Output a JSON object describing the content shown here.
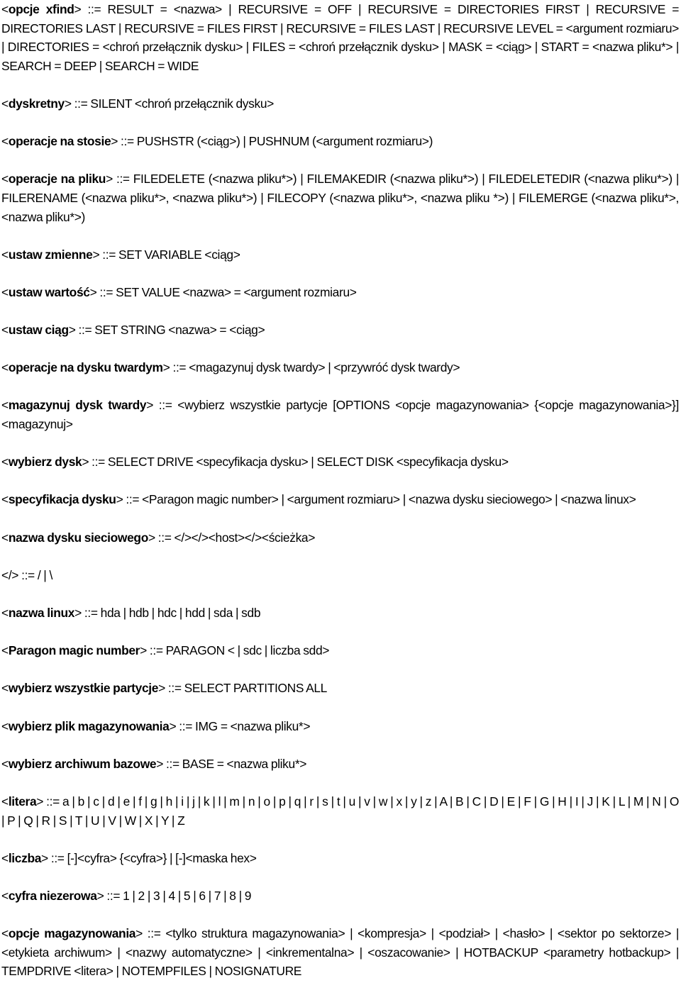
{
  "document": {
    "language": "pl",
    "rules": [
      {
        "term": "opcje xfind",
        "definition": " ::= RESULT = <nazwa> | RECURSIVE = OFF | RECURSIVE = DIRECTORIES FIRST | RECURSIVE = DIRECTORIES LAST | RECURSIVE = FILES FIRST | RECURSIVE = FILES LAST | RECURSIVE LEVEL = <argument rozmiaru> | DIRECTORIES = <chroń przełącznik dysku> | FILES = <chroń przełącznik dysku> | MASK = <ciąg> | START = <nazwa pliku*> | SEARCH = DEEP | SEARCH = WIDE"
      },
      {
        "term": "dyskretny",
        "definition": " ::= SILENT <chroń przełącznik dysku>"
      },
      {
        "term": "operacje na stosie",
        "definition": " ::= PUSHSTR (<ciąg>) | PUSHNUM (<argument rozmiaru>)"
      },
      {
        "term": "operacje na pliku",
        "definition": " ::= FILEDELETE (<nazwa pliku*>) | FILEMAKEDIR (<nazwa pliku*>) | FILEDELETEDIR (<nazwa pliku*>) | FILERENAME (<nazwa pliku*>, <nazwa pliku*>) | FILECOPY (<nazwa pliku*>, <nazwa pliku *>) | FILEMERGE (<nazwa pliku*>, <nazwa pliku*>)"
      },
      {
        "term": "ustaw zmienne",
        "definition": " ::= SET VARIABLE <ciąg>"
      },
      {
        "term": "ustaw wartość",
        "definition": " ::= SET VALUE <nazwa> = <argument rozmiaru>"
      },
      {
        "term": "ustaw ciąg",
        "definition": " ::= SET STRING <nazwa> = <ciąg>"
      },
      {
        "term": "operacje na dysku twardym",
        "definition": " ::= <magazynuj dysk twardy> | <przywróć dysk twardy>"
      },
      {
        "term": "magazynuj dysk twardy",
        "definition": " ::= <wybierz wszystkie partycje [OPTIONS <opcje magazynowania> {<opcje magazynowania>}] <magazynuj>"
      },
      {
        "term": "wybierz dysk",
        "definition": " ::= SELECT DRIVE <specyfikacja dysku> | SELECT DISK <specyfikacja dysku>"
      },
      {
        "term": "specyfikacja dysku",
        "definition": " ::= <Paragon magic number> | <argument rozmiaru> | <nazwa dysku sieciowego> | <nazwa linux>"
      },
      {
        "term": "nazwa dysku sieciowego",
        "definition": " ::= </></><host></><ścieżka>"
      },
      {
        "term": "/",
        "definition": " ::= / | \\"
      },
      {
        "term": "nazwa linux",
        "definition": " ::= hda | hdb | hdc | hdd | sda | sdb"
      },
      {
        "term": "Paragon magic number",
        "definition": " ::= PARAGON < | sdc | liczba sdd>"
      },
      {
        "term": "wybierz wszystkie partycje",
        "definition": " ::= SELECT PARTITIONS ALL"
      },
      {
        "term": "wybierz plik magazynowania",
        "definition": " ::= IMG = <nazwa pliku*>"
      },
      {
        "term": "wybierz archiwum bazowe",
        "definition": " ::= BASE = <nazwa pliku*>"
      },
      {
        "term": "litera",
        "definition": " ::= a | b | c | d | e | f | g | h | i | j | k | l | m | n | o | p | q | r | s | t | u | v | w | x | y | z | A | B | C | D | E | F | G | H | I | J | K | L | M | N | O | P | Q | R | S | T | U | V | W | X | Y | Z"
      },
      {
        "term": "liczba",
        "definition": " ::= [-]<cyfra> {<cyfra>} | [-]<maska hex>"
      },
      {
        "term": "cyfra niezerowa",
        "definition": " ::= 1 | 2 | 3 | 4 | 5 | 6 | 7 | 8 | 9"
      },
      {
        "term": "opcje magazynowania",
        "definition": " ::= <tylko struktura magazynowania> | <kompresja> | <podział> | <hasło> | <sektor po sektorze> | <etykieta archiwum> | <nazwy automatyczne> | <inkrementalna> | <oszacowanie> | HOTBACKUP <parametry hotbackup> | TEMPDRIVE <litera> | NOTEMPFILES | NOSIGNATURE"
      }
    ]
  }
}
